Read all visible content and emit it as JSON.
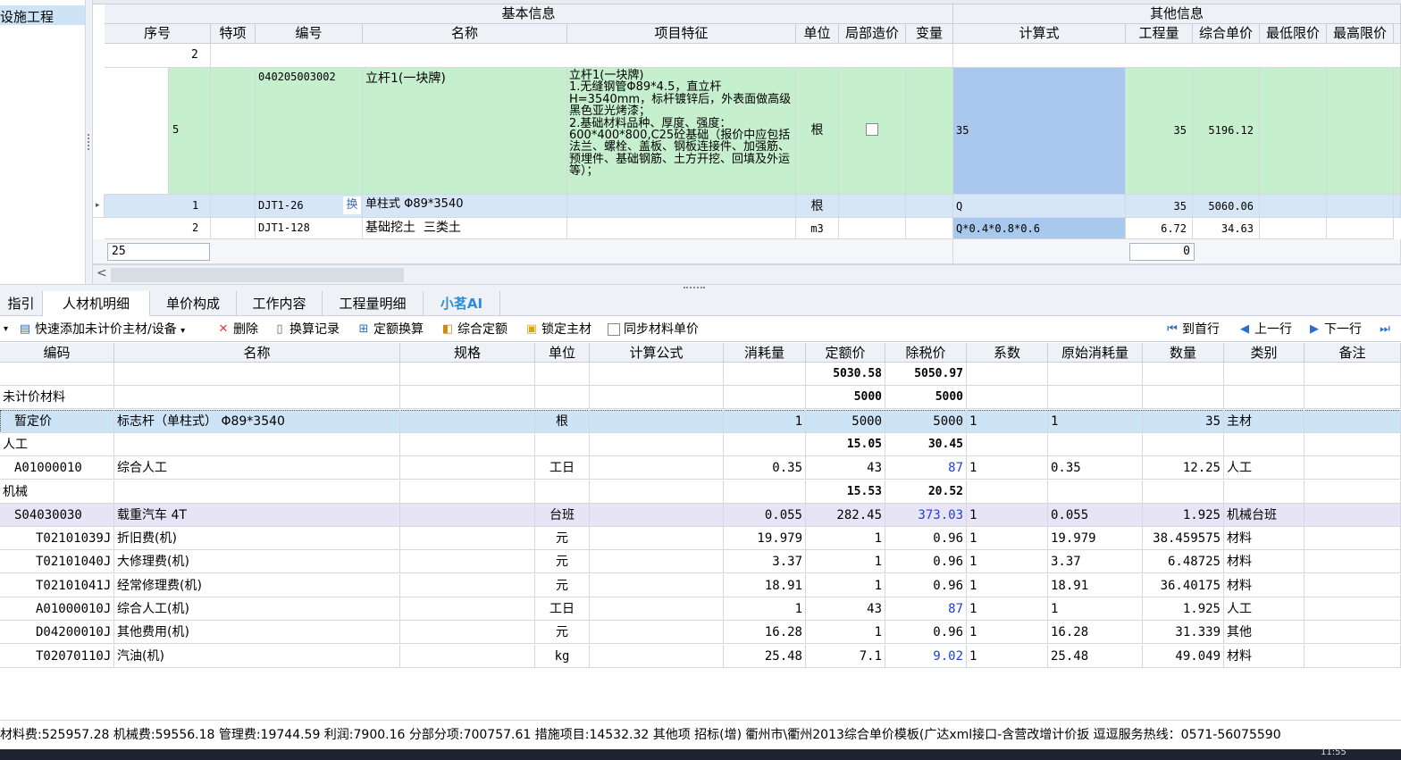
{
  "left_tree": {
    "selected": "设施工程"
  },
  "top_grid": {
    "group_basic": "基本信息",
    "group_other": "其他信息",
    "headers": [
      "序号",
      "特项",
      "编号",
      "名称",
      "项目特征",
      "单位",
      "局部造价",
      "变量",
      "计算式",
      "工程量",
      "综合单价",
      "最低限价",
      "最高限价"
    ],
    "row_prev": {
      "no": "2"
    },
    "row_main": {
      "no": "5",
      "code": "040205003002",
      "name": "立杆1(一块牌)",
      "feature": "立杆1(一块牌)\n1.无缝钢管Φ89*4.5，直立杆H=3540mm，标杆镀锌后，外表面做高级黑色亚光烤漆；\n2.基础材料品种、厚度、强度：600*400*800,C25砼基础（报价中应包括法兰、螺栓、盖板、钢板连接件、加强筋、预埋件、基础钢筋、土方开挖、回填及外运等）；",
      "unit": "根",
      "formula": "35",
      "qty": "35",
      "price": "5196.12"
    },
    "sub_rows": [
      {
        "no": "1",
        "code": "DJT1-26",
        "mark": "换",
        "name": "单柱式 Φ89*3540",
        "unit": "根",
        "formula": "Q",
        "qty": "35",
        "price": "5060.06"
      },
      {
        "no": "2",
        "code": "DJT1-128",
        "mark": "",
        "name": "基础挖土  三类土",
        "unit": "m3",
        "formula": "Q*0.4*0.8*0.6",
        "qty": "6.72",
        "price": "34.63"
      }
    ],
    "input_left": "25",
    "input_right": "0"
  },
  "tabs": [
    "指引",
    "人材机明细",
    "单价构成",
    "工作内容",
    "工程量明细",
    "小茗AI"
  ],
  "toolbar": {
    "quick_add": "快速添加未计价主材/设备",
    "delete": "删除",
    "history": "换算记录",
    "quota_conv": "定额换算",
    "composite": "综合定额",
    "lock": "锁定主材",
    "sync": "同步材料单价",
    "first": "到首行",
    "prev": "上一行",
    "next": "下一行"
  },
  "bottom_grid": {
    "headers": [
      "编码",
      "名称",
      "规格",
      "单位",
      "计算公式",
      "消耗量",
      "定额价",
      "除税价",
      "系数",
      "原始消耗量",
      "数量",
      "类别",
      "备注"
    ],
    "rows": [
      {
        "code": "",
        "name": "",
        "unit": "",
        "consume": "",
        "quota": "5030.58",
        "notax": "5050.97",
        "coef": "",
        "orig": "",
        "count": "",
        "cat": "",
        "style": "total"
      },
      {
        "code": "未计价材料",
        "name": "",
        "unit": "",
        "consume": "",
        "quota": "5000",
        "notax": "5000",
        "coef": "",
        "orig": "",
        "count": "",
        "cat": "",
        "style": "group"
      },
      {
        "code": "暂定价",
        "name": "标志杆（单柱式） Φ89*3540",
        "unit": "根",
        "consume": "1",
        "quota": "5000",
        "notax": "5000",
        "coef": "1",
        "orig": "1",
        "count": "35",
        "cat": "主材",
        "style": "selected"
      },
      {
        "code": "人工",
        "name": "",
        "unit": "",
        "consume": "",
        "quota": "15.05",
        "notax": "30.45",
        "coef": "",
        "orig": "",
        "count": "",
        "cat": "",
        "style": "group"
      },
      {
        "code": "A01000010",
        "name": "综合人工",
        "unit": "工日",
        "consume": "0.35",
        "quota": "43",
        "notax": "87",
        "coef": "1",
        "orig": "0.35",
        "count": "12.25",
        "cat": "人工",
        "style": "item",
        "blue": true
      },
      {
        "code": "机械",
        "name": "",
        "unit": "",
        "consume": "",
        "quota": "15.53",
        "notax": "20.52",
        "coef": "",
        "orig": "",
        "count": "",
        "cat": "",
        "style": "group"
      },
      {
        "code": "S04030030",
        "name": "载重汽车 4T",
        "unit": "台班",
        "consume": "0.055",
        "quota": "282.45",
        "notax": "373.03",
        "coef": "1",
        "orig": "0.055",
        "count": "1.925",
        "cat": "机械台班",
        "style": "purple",
        "blue": true
      },
      {
        "code": "T02101039J",
        "name": "折旧费(机)",
        "unit": "元",
        "consume": "19.979",
        "quota": "1",
        "notax": "0.96",
        "coef": "1",
        "orig": "19.979",
        "count": "38.459575",
        "cat": "材料",
        "style": "child"
      },
      {
        "code": "T02101040J",
        "name": "大修理费(机)",
        "unit": "元",
        "consume": "3.37",
        "quota": "1",
        "notax": "0.96",
        "coef": "1",
        "orig": "3.37",
        "count": "6.48725",
        "cat": "材料",
        "style": "child"
      },
      {
        "code": "T02101041J",
        "name": "经常修理费(机)",
        "unit": "元",
        "consume": "18.91",
        "quota": "1",
        "notax": "0.96",
        "coef": "1",
        "orig": "18.91",
        "count": "36.40175",
        "cat": "材料",
        "style": "child"
      },
      {
        "code": "A01000010J",
        "name": "综合人工(机)",
        "unit": "工日",
        "consume": "1",
        "quota": "43",
        "notax": "87",
        "coef": "1",
        "orig": "1",
        "count": "1.925",
        "cat": "人工",
        "style": "child",
        "blue": true
      },
      {
        "code": "D04200010J",
        "name": "其他费用(机)",
        "unit": "元",
        "consume": "16.28",
        "quota": "1",
        "notax": "0.96",
        "coef": "1",
        "orig": "16.28",
        "count": "31.339",
        "cat": "其他",
        "style": "child"
      },
      {
        "code": "T02070110J",
        "name": "汽油(机)",
        "unit": "kg",
        "consume": "25.48",
        "quota": "7.1",
        "notax": "9.02",
        "coef": "1",
        "orig": "25.48",
        "count": "49.049",
        "cat": "材料",
        "style": "child",
        "blue": true
      }
    ]
  },
  "status_bar": "材料费:525957.28 机械费:59556.18 管理费:19744.59 利润:7900.16 分部分项:700757.61 措施项目:14532.32 其他项 招标(增)   衢州市\\衢州2013综合单价模板(广达xml接口-含营改增计价扳 逗逗服务热线：0571-56075590",
  "taskbar_time": "11:55",
  "colors": {
    "selected": "#cde3f6",
    "green": "#c6efce",
    "purple": "#e8e4f6",
    "blue_text": "#1f3fd6"
  }
}
